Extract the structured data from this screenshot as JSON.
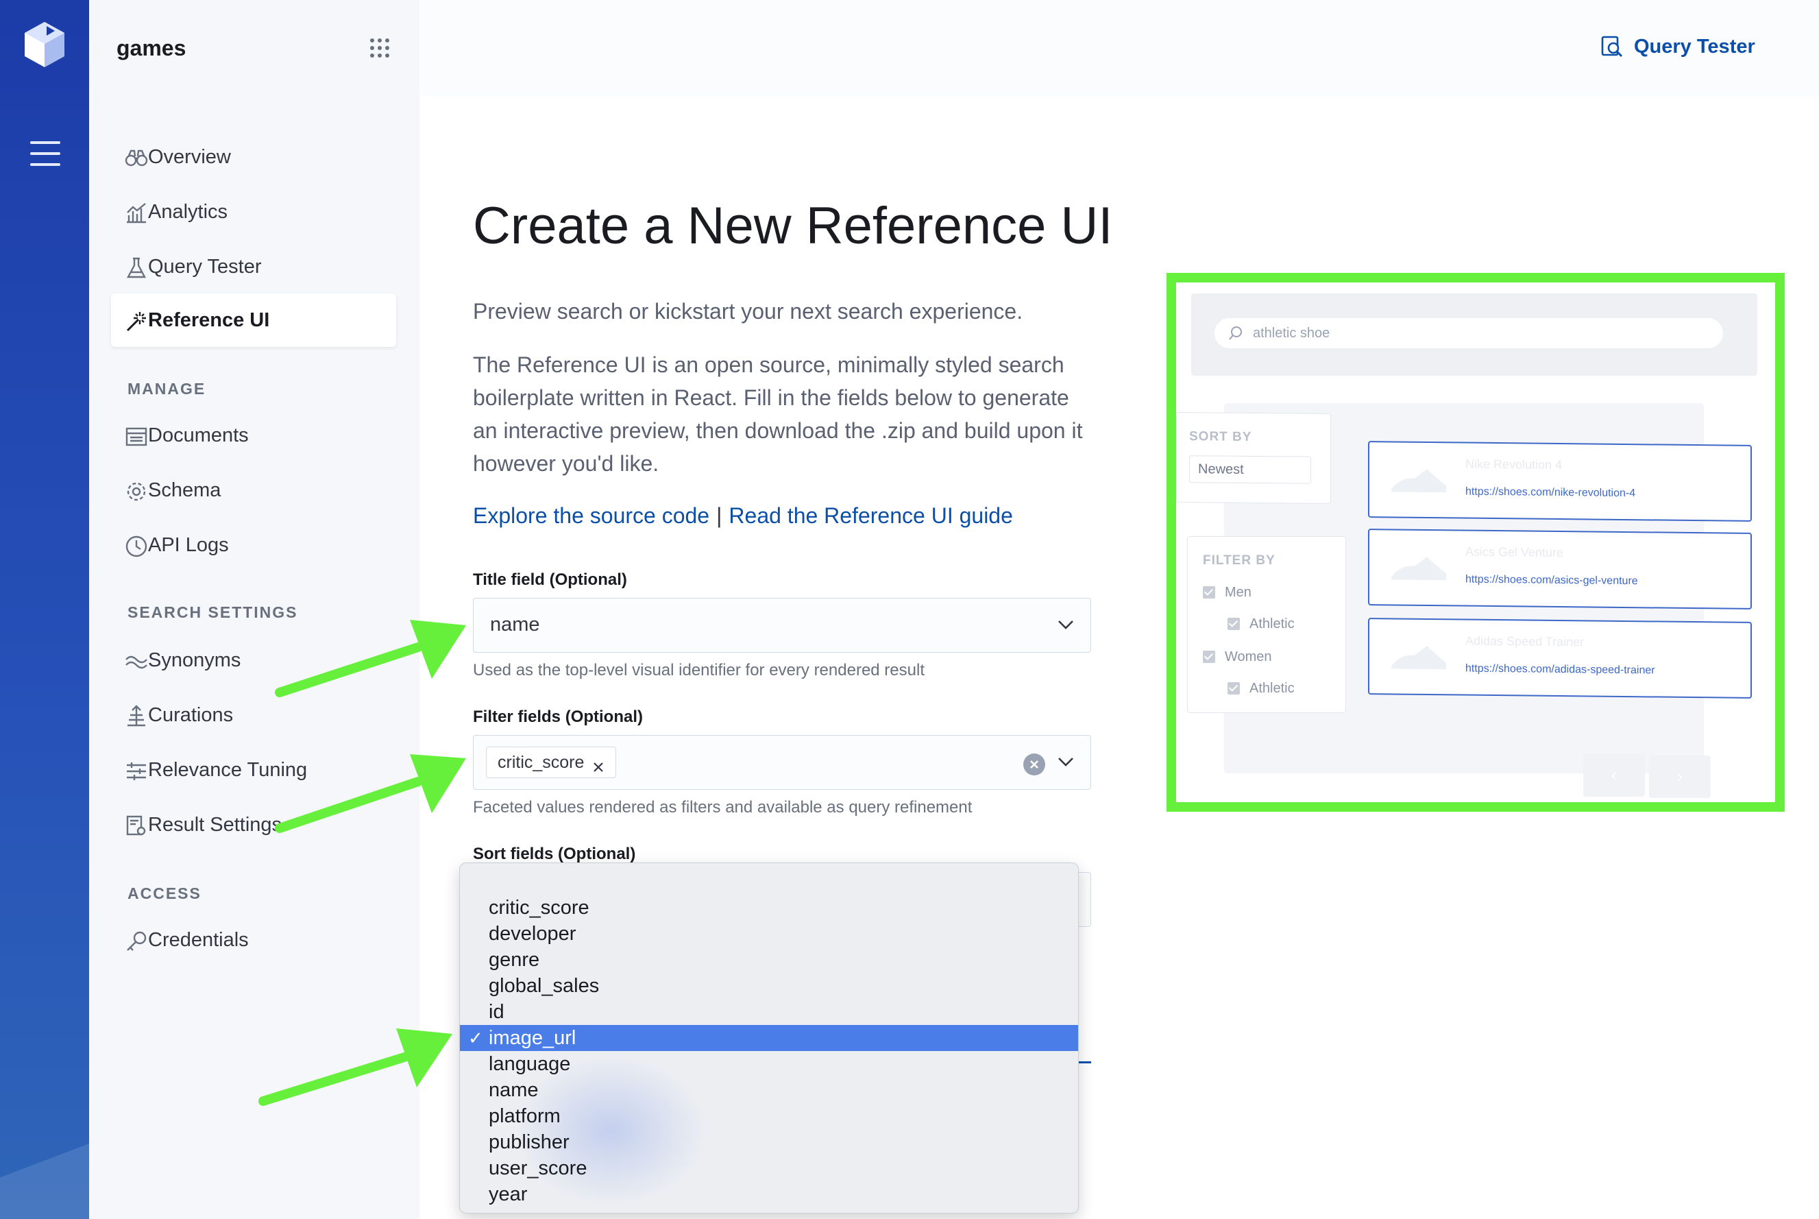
{
  "sidebar": {
    "engine_name": "games",
    "nav": [
      {
        "label": "Overview",
        "icon": "binoculars-icon"
      },
      {
        "label": "Analytics",
        "icon": "chart-icon"
      },
      {
        "label": "Query Tester",
        "icon": "beaker-icon"
      },
      {
        "label": "Reference UI",
        "icon": "magic-wand-icon",
        "active": true
      }
    ],
    "manage_label": "MANAGE",
    "manage": [
      {
        "label": "Documents",
        "icon": "table-icon"
      },
      {
        "label": "Schema",
        "icon": "gear-icon"
      },
      {
        "label": "API Logs",
        "icon": "clock-icon"
      }
    ],
    "search_settings_label": "SEARCH SETTINGS",
    "search_settings": [
      {
        "label": "Synonyms",
        "icon": "synonym-icon"
      },
      {
        "label": "Curations",
        "icon": "curation-icon"
      },
      {
        "label": "Relevance Tuning",
        "icon": "sliders-icon"
      },
      {
        "label": "Result Settings",
        "icon": "result-settings-icon"
      }
    ],
    "access_label": "ACCESS",
    "access": [
      {
        "label": "Credentials",
        "icon": "key-icon"
      }
    ]
  },
  "header": {
    "query_tester_link": "Query Tester"
  },
  "main": {
    "title": "Create a New Reference UI",
    "intro": "Preview search or kickstart your next search experience.",
    "description": "The Reference UI is an open source, minimally styled search boilerplate written in React. Fill in the fields below to generate an interactive preview, then download the .zip and build upon it however you'd like.",
    "link_source": "Explore the source code",
    "link_separator": "|",
    "link_guide": "Read the Reference UI guide",
    "title_field": {
      "label": "Title field (Optional)",
      "value": "name",
      "help": "Used as the top-level visual identifier for every rendered result"
    },
    "filter_fields": {
      "label": "Filter fields (Optional)",
      "chips": [
        "critic_score"
      ],
      "help": "Faceted values rendered as filters and available as query refinement"
    },
    "sort_fields": {
      "label": "Sort fields (Optional)"
    }
  },
  "dropdown": {
    "options": [
      "critic_score",
      "developer",
      "genre",
      "global_sales",
      "id",
      "image_url",
      "language",
      "name",
      "platform",
      "publisher",
      "user_score",
      "year"
    ],
    "selected": "image_url",
    "check_mark": "✓"
  },
  "preview": {
    "search_placeholder": "athletic shoe",
    "sort_by_label": "SORT BY",
    "sort_value": "Newest",
    "filter_by_label": "FILTER BY",
    "filters": [
      {
        "label": "Men",
        "indent": false
      },
      {
        "label": "Athletic",
        "indent": true
      },
      {
        "label": "Women",
        "indent": false
      },
      {
        "label": "Athletic",
        "indent": true
      }
    ],
    "results": [
      {
        "title": "Nike Revolution 4",
        "url": "https://shoes.com/nike-revolution-4"
      },
      {
        "title": "Asics Gel Venture",
        "url": "https://shoes.com/asics-gel-venture"
      },
      {
        "title": "Adidas Speed Trainer",
        "url": "https://shoes.com/adidas-speed-trainer"
      }
    ],
    "pager_prev": "‹",
    "pager_next": "›"
  },
  "colors": {
    "rail": "#1c3ca8",
    "link": "#0b4fa8",
    "highlight_frame": "#66f03c",
    "annotation_arrow": "#66f03c",
    "selected_option": "#4a7de8"
  }
}
